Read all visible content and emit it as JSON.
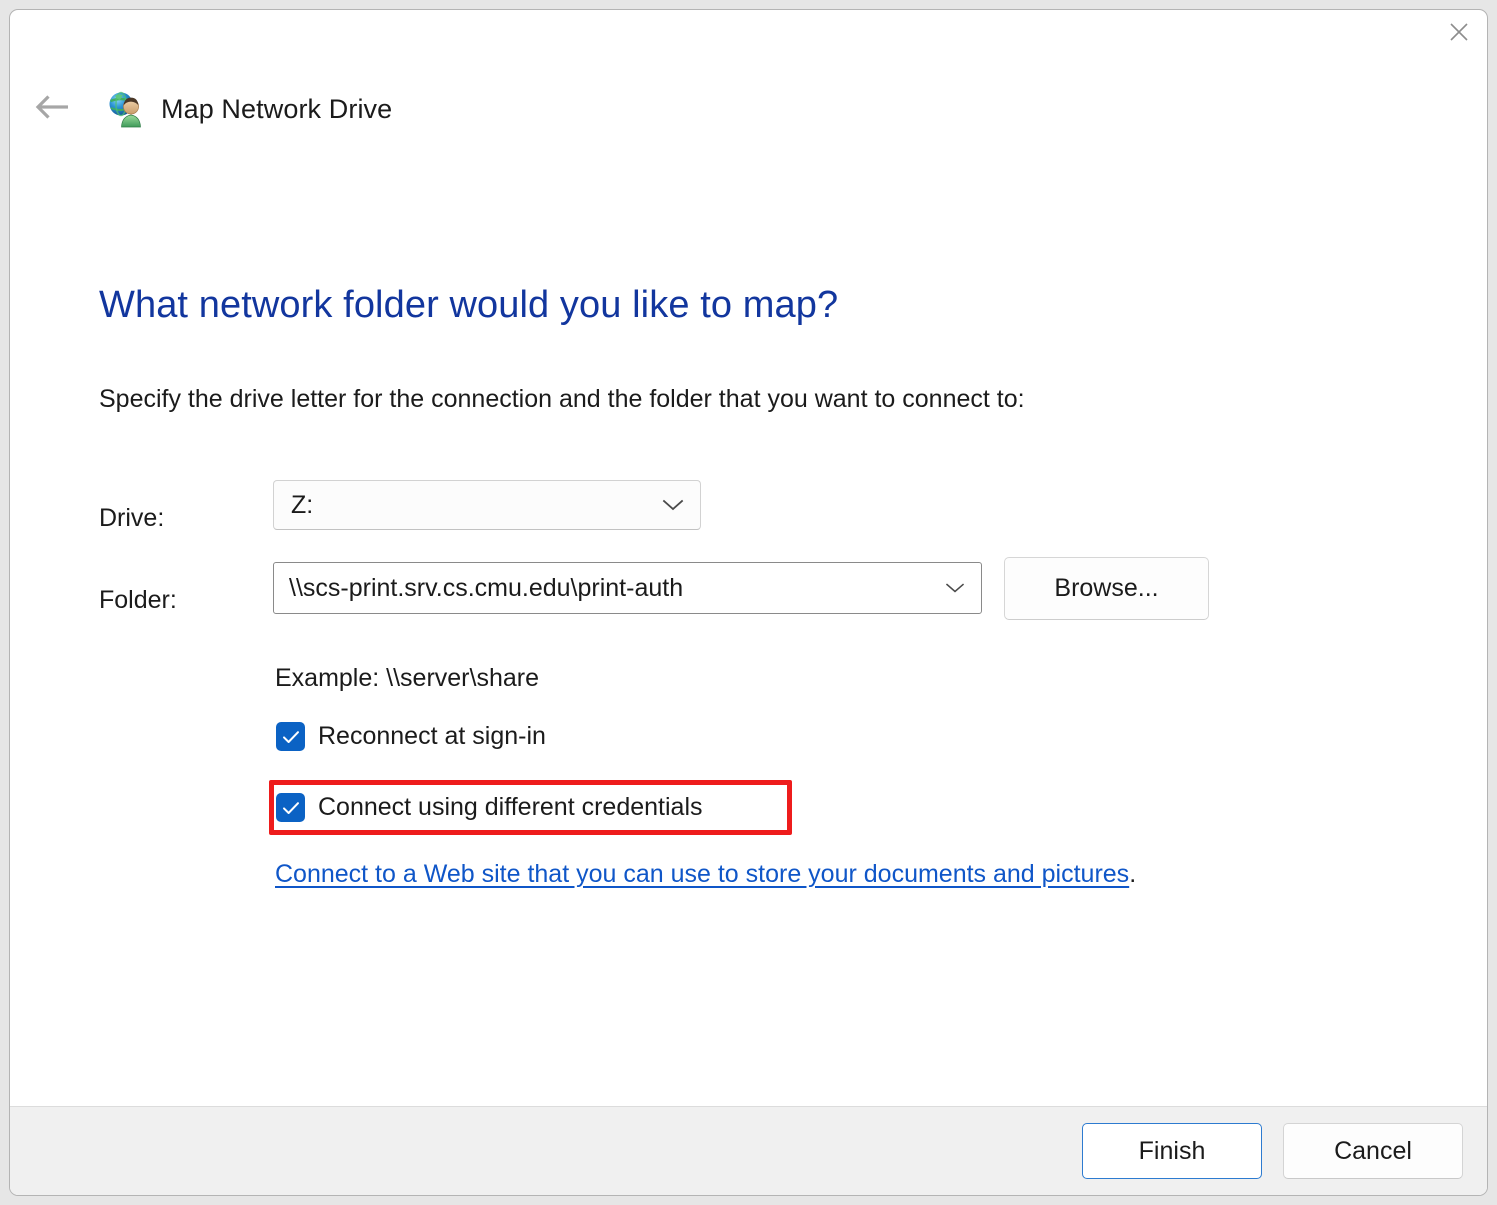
{
  "window": {
    "title": "Map Network Drive",
    "app_icon": "network-user-icon",
    "back_icon": "back-arrow-icon",
    "close_icon": "close-icon"
  },
  "page": {
    "heading": "What network folder would you like to map?",
    "subtext": "Specify the drive letter for the connection and the folder that you want to connect to:",
    "heading_color": "#12369e"
  },
  "form": {
    "drive": {
      "label": "Drive:",
      "value": "Z:",
      "chevron_icon": "chevron-down-icon"
    },
    "folder": {
      "label": "Folder:",
      "value": "\\\\scs-print.srv.cs.cmu.edu\\print-auth",
      "placeholder": "",
      "chevron_icon": "chevron-down-icon",
      "browse_label": "Browse..."
    },
    "example": "Example: \\\\server\\share"
  },
  "options": {
    "reconnect": {
      "label": "Reconnect at sign-in",
      "checked": true
    },
    "different_credentials": {
      "label": "Connect using different credentials",
      "checked": true,
      "highlighted": true,
      "highlight_color": "#ee1c1c"
    }
  },
  "weblink": {
    "text": "Connect to a Web site that you can use to store your documents and pictures",
    "trailing": ".",
    "color": "#0f56c8"
  },
  "footer": {
    "finish_label": "Finish",
    "cancel_label": "Cancel",
    "accent_color": "#2d7bd0"
  }
}
